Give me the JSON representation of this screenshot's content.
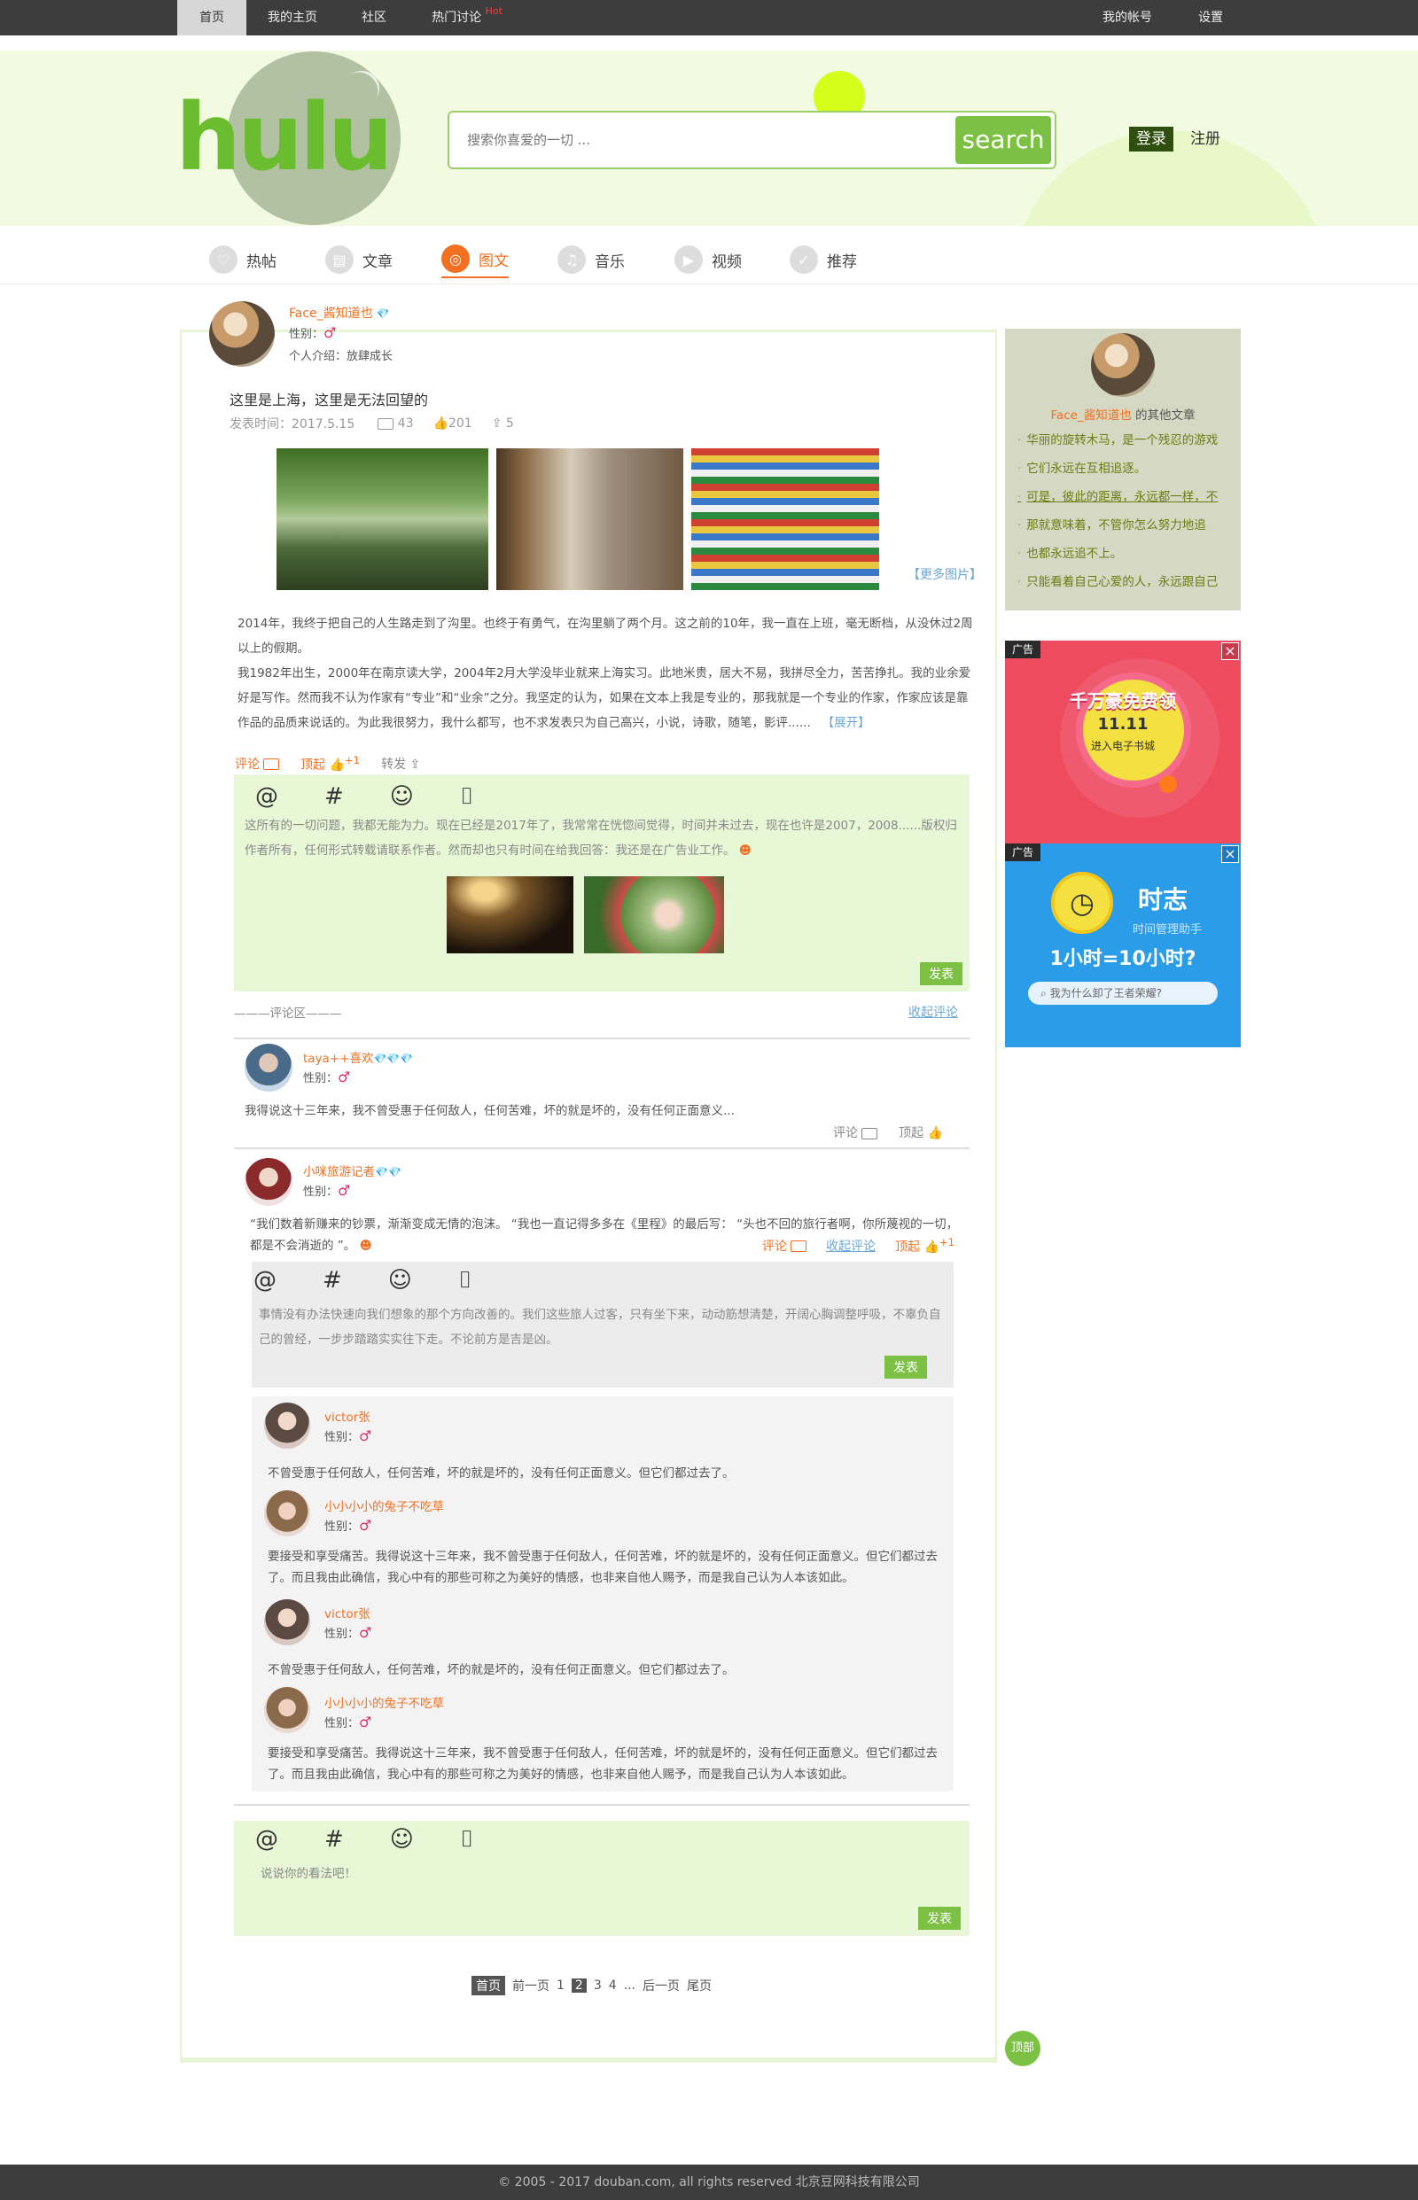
{
  "topnav": {
    "items": [
      {
        "label": "首页",
        "active": true
      },
      {
        "label": "我的主页",
        "active": false
      },
      {
        "label": "社区",
        "active": false
      },
      {
        "label": "热门讨论",
        "active": false
      }
    ],
    "hot_badge": "Hot",
    "account": "我的帐号",
    "settings": "设置"
  },
  "header": {
    "logo_text": "hulu",
    "search_placeholder": "搜索你喜爱的一切 ...",
    "search_button": "search",
    "login": "登录",
    "register": "注册"
  },
  "categories": [
    {
      "label": "热帖",
      "icon": "heart-icon",
      "active": false
    },
    {
      "label": "文章",
      "icon": "document-icon",
      "active": false
    },
    {
      "label": "图文",
      "icon": "image-icon",
      "active": true
    },
    {
      "label": "音乐",
      "icon": "headphones-icon",
      "active": false
    },
    {
      "label": "视频",
      "icon": "video-icon",
      "active": false
    },
    {
      "label": "推荐",
      "icon": "thumbs-up-icon",
      "active": false
    }
  ],
  "post": {
    "author": "Face_酱知道也",
    "gender_label": "性别：",
    "gender_symbol": "♂",
    "bio": "个人介绍：放肆成长",
    "title": "这里是上海，这里是无法回望的",
    "date": "发表时间：2017.5.15",
    "comments": "43",
    "likes": "201",
    "shares": "5",
    "more_images": "【更多图片】",
    "body1": "2014年，我终于把自己的人生路走到了沟里。也终于有勇气，在沟里躺了两个月。这之前的10年，我一直在上班，毫无断档，从没休过2周以上的假期。",
    "body2": "我1982年出生，2000年在南京读大学，2004年2月大学没毕业就来上海实习。此地米贵，居大不易，我拼尽全力，苦苦挣扎。我的业余爱好是写作。然而我不认为作家有“专业”和“业余”之分。我坚定的认为，如果在文本上我是专业的，那我就是一个专业的作家，作家应该是靠作品的品质来说话的。为此我很努力，我什么都写，也不求发表只为自己高兴，小说，诗歌，随笔，影评......",
    "expand": "【展开】",
    "action_comment": "评论",
    "action_up": "顶起",
    "action_up_plus": "+1",
    "action_forward": "转发"
  },
  "composer1": {
    "text": "这所有的一切问题，我都无能为力。现在已经是2017年了，我常常在恍惚间觉得，时间并未过去，现在也许是2007，2008......版权归作者所有，任何形式转载请联系作者。然而却也只有时间在给我回答：我还是在广告业工作。",
    "button": "发表"
  },
  "comments_header": {
    "label": "评论区",
    "collapse": "收起评论"
  },
  "comment1": {
    "author": "taya++喜欢",
    "gender_label": "性别：",
    "gender_symbol": "♂",
    "text": "我得说这十三年来，我不曾受惠于任何敌人，任何苦难，坏的就是坏的，没有任何正面意义...",
    "comment": "评论",
    "up": "顶起"
  },
  "comment2": {
    "author": "小咪旅游记者",
    "gender_label": "性别：",
    "gender_symbol": "♂",
    "text": "“我们数着新赚来的钞票，渐渐变成无情的泡沫。 “我也一直记得多多在《里程》的最后写： “头也不回的旅行者啊，你所蔑视的一切，都是不会消逝的 ”。",
    "comment": "评论",
    "collapse": "收起评论",
    "up": "顶起",
    "up_plus": "+1"
  },
  "composer2": {
    "text": "事情没有办法快速向我们想象的那个方向改善的。我们这些旅人过客，只有坐下来，动动筋想清楚，开阔心胸调整呼吸，不辜负自己的曾经，一步步踏踏实实往下走。不论前方是吉是凶。",
    "button": "发表"
  },
  "replies": [
    {
      "author": "victor张",
      "gender_label": "性别：",
      "gender_symbol": "♂",
      "text": "不曾受惠于任何敌人，任何苦难，坏的就是坏的，没有任何正面意义。但它们都过去了。"
    },
    {
      "author": "小小小小的兔子不吃草",
      "gender_label": "性别：",
      "gender_symbol": "♂",
      "text": "要接受和享受痛苦。我得说这十三年来，我不曾受惠于任何敌人，任何苦难，坏的就是坏的，没有任何正面意义。但它们都过去了。而且我由此确信，我心中有的那些可称之为美好的情感，也非来自他人赐予，而是我自己认为人本该如此。"
    },
    {
      "author": "victor张",
      "gender_label": "性别：",
      "gender_symbol": "♂",
      "text": "不曾受惠于任何敌人，任何苦难，坏的就是坏的，没有任何正面意义。但它们都过去了。"
    },
    {
      "author": "小小小小的兔子不吃草",
      "gender_label": "性别：",
      "gender_symbol": "♂",
      "text": "要接受和享受痛苦。我得说这十三年来，我不曾受惠于任何敌人，任何苦难，坏的就是坏的，没有任何正面意义。但它们都过去了。而且我由此确信，我心中有的那些可称之为美好的情感，也非来自他人赐予，而是我自己认为人本该如此。"
    }
  ],
  "composer3": {
    "placeholder": "说说你的看法吧！",
    "button": "发表"
  },
  "pagination": {
    "first": "首页",
    "prev": "前一页",
    "pages": [
      "1",
      "2",
      "3",
      "4"
    ],
    "current": "2",
    "ellipsis": "...",
    "next": "后一页",
    "last": "尾页"
  },
  "sidebar": {
    "author": "Face_酱知道也",
    "other_articles": "的其他文章",
    "items": [
      "华丽的旋转木马，是一个残忍的游戏",
      "它们永远在互相追逐。",
      "可是，彼此的距离，永远都一样，不",
      "那就意味着，不管你怎么努力地追",
      "也都永远追不上。",
      "只能看着自己心爱的人，永远跟自己"
    ]
  },
  "ad1": {
    "tag": "广告",
    "headline": "千万豪免费领",
    "date": "11.11",
    "sub": "进入电子书城",
    "colors": {
      "bg": "#ef4b5f",
      "circle": "#f4e041"
    }
  },
  "ad2": {
    "tag": "广告",
    "brand": "时志",
    "tagline": "时间管理助手",
    "headline": "1小时=10小时?",
    "search_text": "我为什么卸了王者荣耀?",
    "colors": {
      "bg": "#2b9de8"
    }
  },
  "top_button": "顶部",
  "footer": "© 2005 - 2017 douban.com, all rights reserved 北京豆网科技有限公司",
  "colors": {
    "accent_green": "#7cc144",
    "accent_orange": "#f36f21",
    "header_bg": "#f2fbe1",
    "topbar_bg": "#3d3d3d"
  }
}
